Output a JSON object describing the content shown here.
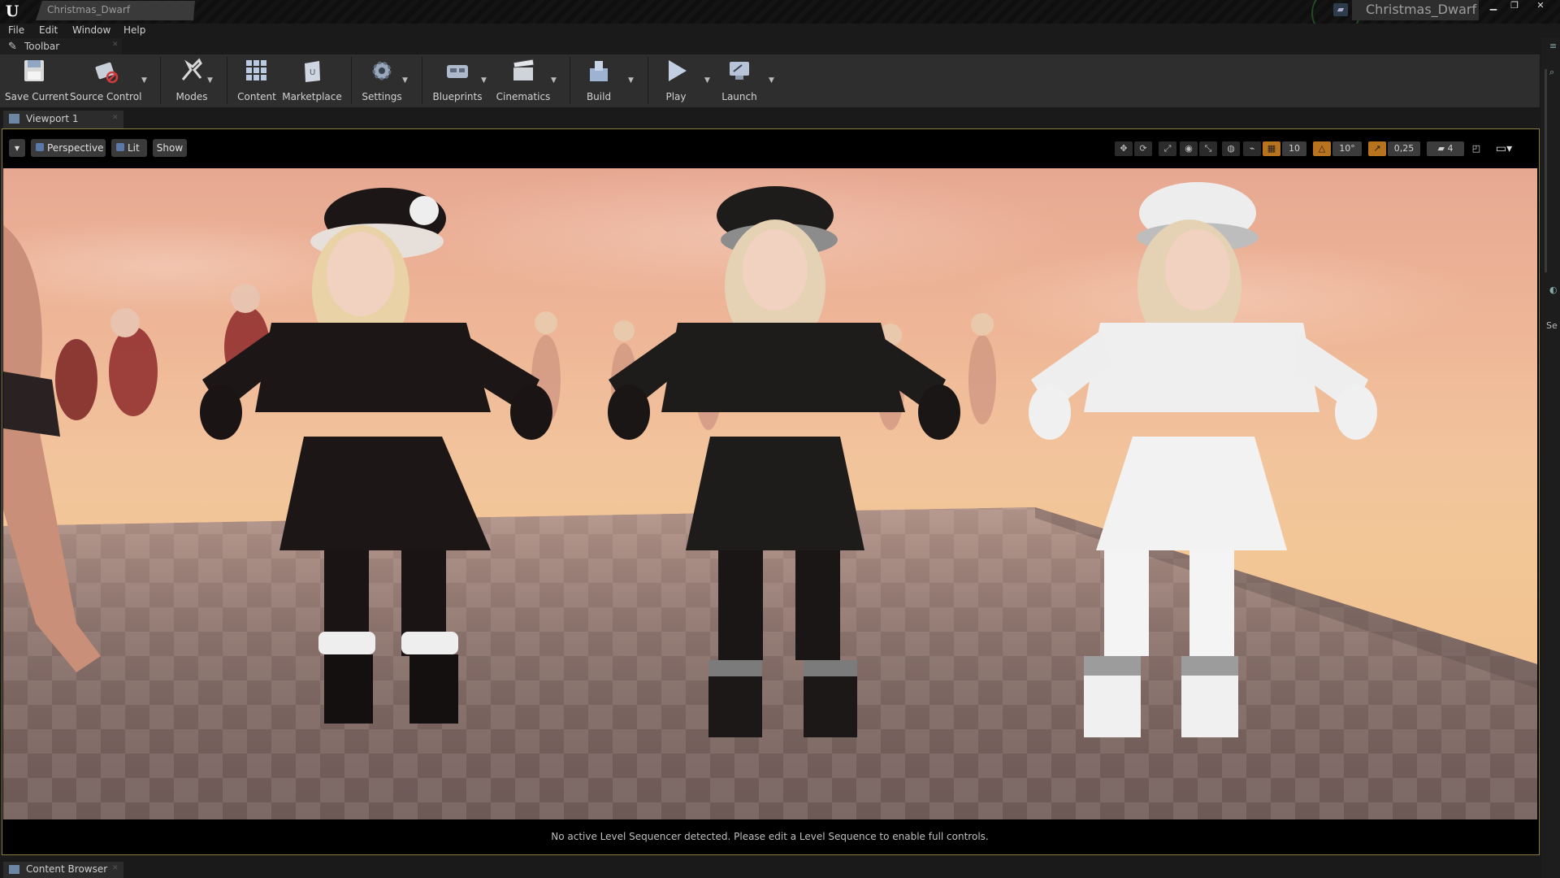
{
  "window": {
    "document_tab": "Christmas_Dwarf",
    "project_name": "Christmas_Dwarf",
    "logo": "unreal-logo",
    "controls": [
      "minimize-icon",
      "restore-icon",
      "close-icon"
    ]
  },
  "menu": [
    "File",
    "Edit",
    "Window",
    "Help"
  ],
  "toolbar_tab": {
    "label": "Toolbar",
    "icon": "wrench-icon"
  },
  "toolbar": {
    "save_current": "Save Current",
    "source_control": "Source Control",
    "modes": "Modes",
    "content": "Content",
    "marketplace": "Marketplace",
    "settings": "Settings",
    "blueprints": "Blueprints",
    "cinematics": "Cinematics",
    "build": "Build",
    "play": "Play",
    "launch": "Launch"
  },
  "viewport_tab": {
    "label": "Viewport 1"
  },
  "viewport_toolbar": {
    "perspective": "Perspective",
    "lit": "Lit",
    "show": "Show",
    "grid_snap": "10",
    "rotation_snap": "10°",
    "scale_snap": "0,25",
    "camera_speed": "4"
  },
  "sequencer_message": "No active Level Sequencer detected. Please edit a Level Sequence to enable full controls.",
  "right_panel": {
    "label": "Se"
  },
  "content_browser_tab": {
    "label": "Content Browser"
  },
  "colors": {
    "accent_gold": "#8c7a3a",
    "sky_top": "#e7a892",
    "sky_horizon": "#f3c696",
    "floor_dark": "#6e5a56",
    "floor_light": "#8a7572",
    "outfit_black": "#1c1616",
    "outfit_white": "#eeeeee"
  }
}
